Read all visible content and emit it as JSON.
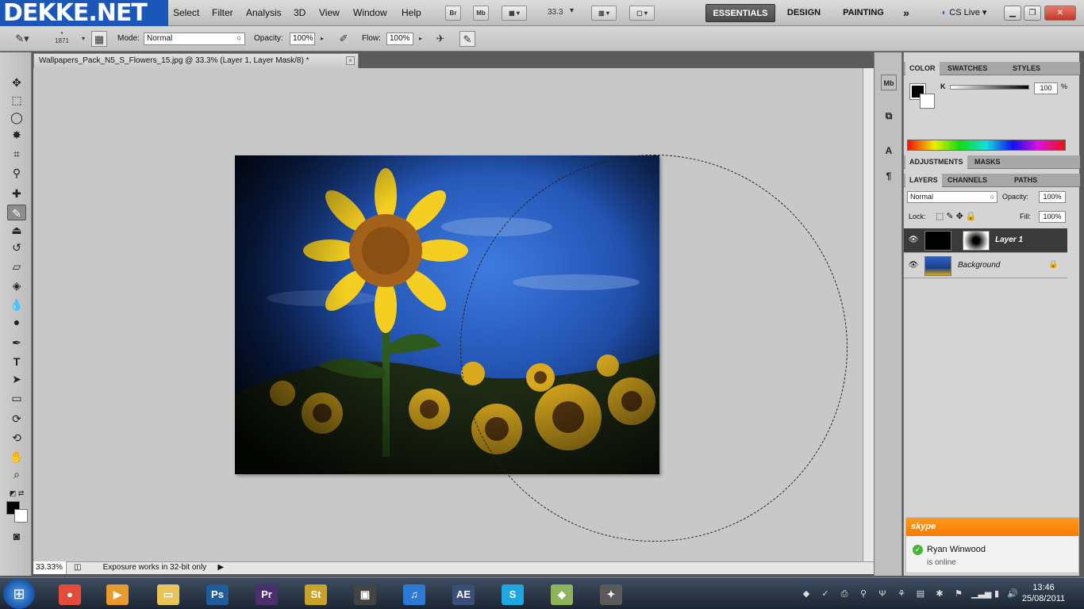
{
  "brand": {
    "logo_text": "DEKKE.NET"
  },
  "menu": [
    "Select",
    "Filter",
    "Analysis",
    "3D",
    "View",
    "Window",
    "Help"
  ],
  "menubar_buttons": {
    "br": "Br",
    "mb": "Mb",
    "zoom": "33.3"
  },
  "workspaces": {
    "essentials": "ESSENTIALS",
    "design": "DESIGN",
    "painting": "PAINTING",
    "more": "»",
    "cslive": "CS Live"
  },
  "options_bar": {
    "brush_size": "1871",
    "mode_label": "Mode:",
    "mode_value": "Normal",
    "opacity_label": "Opacity:",
    "opacity_value": "100%",
    "flow_label": "Flow:",
    "flow_value": "100%"
  },
  "document": {
    "tab_title": "Wallpapers_Pack_N5_S_Flowers_15.jpg @ 33.3% (Layer 1, Layer Mask/8) *",
    "close": "×",
    "zoom_status": "33.33%",
    "status_text": "Exposure works in 32-bit only"
  },
  "color_panel": {
    "tabs": [
      "COLOR",
      "SWATCHES",
      "STYLES"
    ],
    "channel_label": "K",
    "channel_value": "100",
    "unit": "%"
  },
  "adjust_panel": {
    "tabs": [
      "ADJUSTMENTS",
      "MASKS"
    ]
  },
  "layers_panel": {
    "tabs": [
      "LAYERS",
      "CHANNELS",
      "PATHS"
    ],
    "blend_mode": "Normal",
    "opacity_label": "Opacity:",
    "opacity_value": "100%",
    "lock_label": "Lock:",
    "fill_label": "Fill:",
    "fill_value": "100%",
    "layers": [
      {
        "name": "Layer 1",
        "selected": true
      },
      {
        "name": "Background",
        "selected": false
      }
    ]
  },
  "skype": {
    "header": "skype",
    "name": "Ryan Winwood",
    "status": "is online"
  },
  "taskbar": {
    "apps": [
      {
        "name": "chrome",
        "glyph": "●",
        "color": "#e34b3a"
      },
      {
        "name": "media",
        "glyph": "▶",
        "color": "#e89b2c"
      },
      {
        "name": "explorer",
        "glyph": "▭",
        "color": "#e8c45a"
      },
      {
        "name": "photoshop",
        "glyph": "Ps",
        "color": "#1f5c99"
      },
      {
        "name": "premiere",
        "glyph": "Pr",
        "color": "#4a2e6e"
      },
      {
        "name": "soundbooth",
        "glyph": "St",
        "color": "#c9a22a"
      },
      {
        "name": "monitor",
        "glyph": "▣",
        "color": "#444444"
      },
      {
        "name": "itunes",
        "glyph": "♫",
        "color": "#2d7ad6"
      },
      {
        "name": "after-effects",
        "glyph": "AE",
        "color": "#3d4d7a"
      },
      {
        "name": "skype",
        "glyph": "S",
        "color": "#1fa7e0"
      },
      {
        "name": "notes",
        "glyph": "◆",
        "color": "#8fb35a"
      },
      {
        "name": "torch",
        "glyph": "✦",
        "color": "#5a5a5a"
      }
    ],
    "time": "13:46",
    "date": "25/08/2011"
  },
  "colors": {
    "accent": "#1a57b8",
    "skype_orange": "#f57a00"
  }
}
